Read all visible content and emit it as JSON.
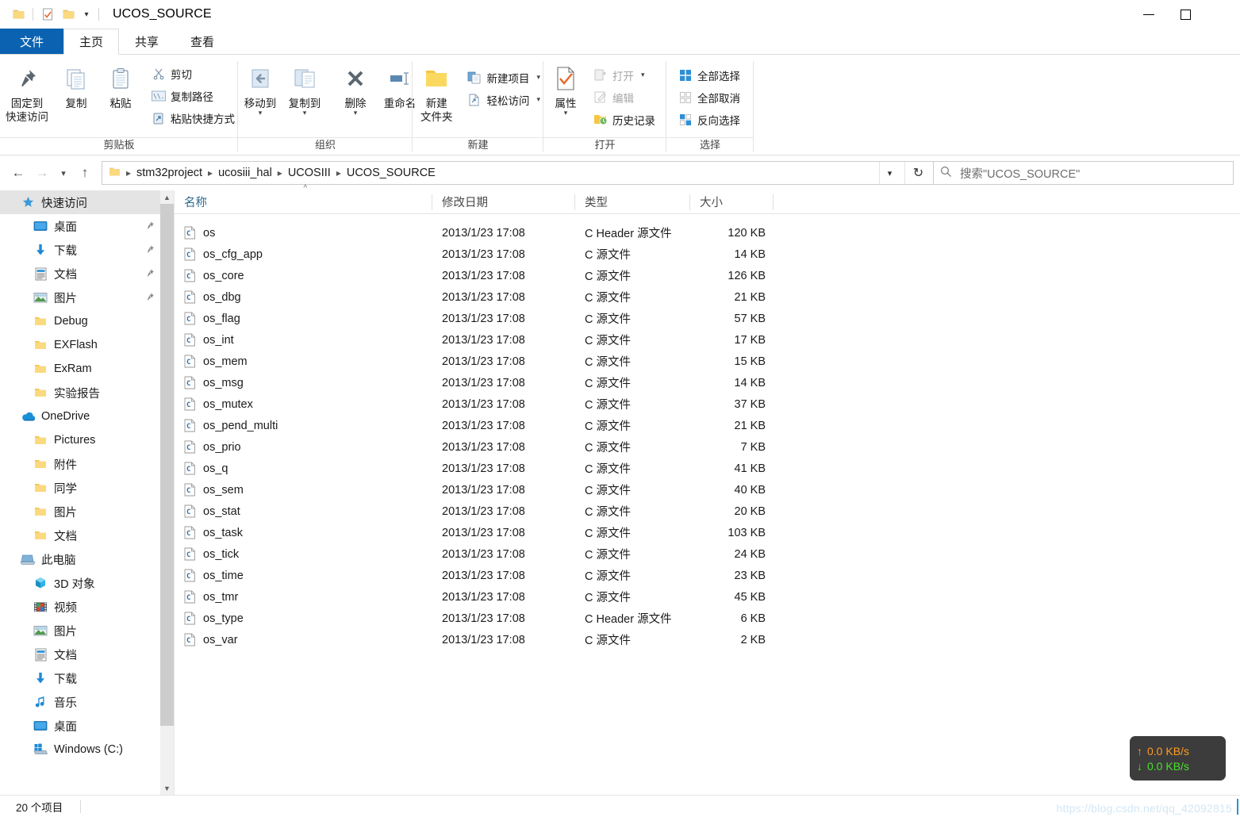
{
  "window": {
    "title": "UCOS_SOURCE",
    "minimize_label": "最小化",
    "maximize_label": "最大化",
    "quick_access": [
      "folder-icon",
      "properties-check-icon",
      "new-folder-icon",
      "customize-caret-icon"
    ]
  },
  "ribbon": {
    "tabs": [
      {
        "label": "文件",
        "kind": "file"
      },
      {
        "label": "主页",
        "kind": "active"
      },
      {
        "label": "共享",
        "kind": "normal"
      },
      {
        "label": "查看",
        "kind": "normal"
      }
    ],
    "groups": [
      {
        "name": "剪贴板",
        "big": [
          {
            "label_line1": "固定到",
            "label_line2": "快速访问",
            "icon": "pin-icon"
          },
          {
            "label_line1": "复制",
            "label_line2": "",
            "icon": "copy-icon"
          },
          {
            "label_line1": "粘贴",
            "label_line2": "",
            "icon": "paste-icon"
          }
        ],
        "small": [
          {
            "label": "剪切",
            "icon": "scissors-icon"
          },
          {
            "label": "复制路径",
            "icon": "copy-path-icon"
          },
          {
            "label": "粘贴快捷方式",
            "icon": "paste-shortcut-icon"
          }
        ]
      },
      {
        "name": "组织",
        "big": [
          {
            "label_line1": "移动到",
            "label_line2": "",
            "icon": "move-to-icon",
            "caret": true
          },
          {
            "label_line1": "复制到",
            "label_line2": "",
            "icon": "copy-to-icon",
            "caret": true
          },
          {
            "label_line1": "删除",
            "label_line2": "",
            "icon": "delete-x-icon",
            "caret": true
          },
          {
            "label_line1": "重命名",
            "label_line2": "",
            "icon": "rename-icon"
          }
        ],
        "small": []
      },
      {
        "name": "新建",
        "big": [
          {
            "label_line1": "新建",
            "label_line2": "文件夹",
            "icon": "new-folder-icon"
          }
        ],
        "small": [
          {
            "label": "新建项目",
            "icon": "new-item-icon",
            "caret": true
          },
          {
            "label": "轻松访问",
            "icon": "easy-access-icon",
            "caret": true
          }
        ]
      },
      {
        "name": "打开",
        "big": [
          {
            "label_line1": "属性",
            "label_line2": "",
            "icon": "properties-icon",
            "caret": true
          }
        ],
        "small": [
          {
            "label": "打开",
            "icon": "open-icon",
            "caret": true,
            "dim": true
          },
          {
            "label": "编辑",
            "icon": "edit-icon",
            "dim": true
          },
          {
            "label": "历史记录",
            "icon": "history-icon"
          }
        ]
      },
      {
        "name": "选择",
        "big": [],
        "small": [
          {
            "label": "全部选择",
            "icon": "select-all-icon"
          },
          {
            "label": "全部取消",
            "icon": "select-none-icon"
          },
          {
            "label": "反向选择",
            "icon": "invert-selection-icon"
          }
        ]
      }
    ]
  },
  "addressbar": {
    "back_icon": "back-arrow-icon",
    "forward_icon": "forward-arrow-icon",
    "recent_icon": "recent-locations-icon",
    "up_icon": "up-arrow-icon",
    "breadcrumbs": [
      "stm32project",
      "ucosiii_hal",
      "UCOSIII",
      "UCOS_SOURCE"
    ],
    "dropdown_icon": "chevron-down-icon",
    "refresh_icon": "refresh-icon"
  },
  "search": {
    "icon": "search-icon",
    "placeholder": "搜索\"UCOS_SOURCE\"",
    "value": ""
  },
  "sidebar": {
    "items": [
      {
        "label": "快速访问",
        "icon": "quick-access-star-icon",
        "level": 0,
        "selected": true,
        "pin": false
      },
      {
        "label": "桌面",
        "icon": "desktop-icon",
        "level": 1,
        "selected": false,
        "pin": true
      },
      {
        "label": "下载",
        "icon": "downloads-icon",
        "level": 1,
        "selected": false,
        "pin": true
      },
      {
        "label": "文档",
        "icon": "documents-icon",
        "level": 1,
        "selected": false,
        "pin": true
      },
      {
        "label": "图片",
        "icon": "pictures-icon",
        "level": 1,
        "selected": false,
        "pin": true
      },
      {
        "label": "Debug",
        "icon": "folder-icon",
        "level": 1,
        "selected": false,
        "pin": false
      },
      {
        "label": "EXFlash",
        "icon": "folder-icon",
        "level": 1,
        "selected": false,
        "pin": false
      },
      {
        "label": "ExRam",
        "icon": "folder-icon",
        "level": 1,
        "selected": false,
        "pin": false
      },
      {
        "label": "实验报告",
        "icon": "folder-icon",
        "level": 1,
        "selected": false,
        "pin": false
      },
      {
        "label": "OneDrive",
        "icon": "onedrive-cloud-icon",
        "level": 0,
        "selected": false,
        "pin": false
      },
      {
        "label": "Pictures",
        "icon": "folder-icon",
        "level": 1,
        "selected": false,
        "pin": false
      },
      {
        "label": "附件",
        "icon": "folder-icon",
        "level": 1,
        "selected": false,
        "pin": false
      },
      {
        "label": "同学",
        "icon": "folder-icon",
        "level": 1,
        "selected": false,
        "pin": false
      },
      {
        "label": "图片",
        "icon": "folder-icon",
        "level": 1,
        "selected": false,
        "pin": false
      },
      {
        "label": "文档",
        "icon": "folder-icon",
        "level": 1,
        "selected": false,
        "pin": false
      },
      {
        "label": "此电脑",
        "icon": "this-pc-icon",
        "level": 0,
        "selected": false,
        "pin": false
      },
      {
        "label": "3D 对象",
        "icon": "3d-objects-icon",
        "level": 1,
        "selected": false,
        "pin": false
      },
      {
        "label": "视频",
        "icon": "videos-icon",
        "level": 1,
        "selected": false,
        "pin": false
      },
      {
        "label": "图片",
        "icon": "pictures-icon",
        "level": 1,
        "selected": false,
        "pin": false
      },
      {
        "label": "文档",
        "icon": "documents-icon",
        "level": 1,
        "selected": false,
        "pin": false
      },
      {
        "label": "下载",
        "icon": "downloads-icon",
        "level": 1,
        "selected": false,
        "pin": false
      },
      {
        "label": "音乐",
        "icon": "music-icon",
        "level": 1,
        "selected": false,
        "pin": false
      },
      {
        "label": "桌面",
        "icon": "desktop-icon",
        "level": 1,
        "selected": false,
        "pin": false
      },
      {
        "label": "Windows (C:)",
        "icon": "windows-drive-icon",
        "level": 1,
        "selected": false,
        "pin": false
      }
    ]
  },
  "filelist": {
    "columns": [
      {
        "label": "名称",
        "key": "name",
        "sorted": true,
        "sort_dir": "asc"
      },
      {
        "label": "修改日期",
        "key": "date",
        "sorted": false
      },
      {
        "label": "类型",
        "key": "type",
        "sorted": false
      },
      {
        "label": "大小",
        "key": "size",
        "sorted": false
      }
    ],
    "rows": [
      {
        "name": "os",
        "date": "2013/1/23 17:08",
        "type": "C Header 源文件",
        "size": "120 KB"
      },
      {
        "name": "os_cfg_app",
        "date": "2013/1/23 17:08",
        "type": "C 源文件",
        "size": "14 KB"
      },
      {
        "name": "os_core",
        "date": "2013/1/23 17:08",
        "type": "C 源文件",
        "size": "126 KB"
      },
      {
        "name": "os_dbg",
        "date": "2013/1/23 17:08",
        "type": "C 源文件",
        "size": "21 KB"
      },
      {
        "name": "os_flag",
        "date": "2013/1/23 17:08",
        "type": "C 源文件",
        "size": "57 KB"
      },
      {
        "name": "os_int",
        "date": "2013/1/23 17:08",
        "type": "C 源文件",
        "size": "17 KB"
      },
      {
        "name": "os_mem",
        "date": "2013/1/23 17:08",
        "type": "C 源文件",
        "size": "15 KB"
      },
      {
        "name": "os_msg",
        "date": "2013/1/23 17:08",
        "type": "C 源文件",
        "size": "14 KB"
      },
      {
        "name": "os_mutex",
        "date": "2013/1/23 17:08",
        "type": "C 源文件",
        "size": "37 KB"
      },
      {
        "name": "os_pend_multi",
        "date": "2013/1/23 17:08",
        "type": "C 源文件",
        "size": "21 KB"
      },
      {
        "name": "os_prio",
        "date": "2013/1/23 17:08",
        "type": "C 源文件",
        "size": "7 KB"
      },
      {
        "name": "os_q",
        "date": "2013/1/23 17:08",
        "type": "C 源文件",
        "size": "41 KB"
      },
      {
        "name": "os_sem",
        "date": "2013/1/23 17:08",
        "type": "C 源文件",
        "size": "40 KB"
      },
      {
        "name": "os_stat",
        "date": "2013/1/23 17:08",
        "type": "C 源文件",
        "size": "20 KB"
      },
      {
        "name": "os_task",
        "date": "2013/1/23 17:08",
        "type": "C 源文件",
        "size": "103 KB"
      },
      {
        "name": "os_tick",
        "date": "2013/1/23 17:08",
        "type": "C 源文件",
        "size": "24 KB"
      },
      {
        "name": "os_time",
        "date": "2013/1/23 17:08",
        "type": "C 源文件",
        "size": "23 KB"
      },
      {
        "name": "os_tmr",
        "date": "2013/1/23 17:08",
        "type": "C 源文件",
        "size": "45 KB"
      },
      {
        "name": "os_type",
        "date": "2013/1/23 17:08",
        "type": "C Header 源文件",
        "size": "6 KB"
      },
      {
        "name": "os_var",
        "date": "2013/1/23 17:08",
        "type": "C 源文件",
        "size": "2 KB"
      }
    ]
  },
  "statusbar": {
    "item_count": "20 个项目"
  },
  "speed_widget": {
    "upload": "0.0 KB/s",
    "download": "0.0 KB/s",
    "upload_color": "#ff9b21",
    "download_color": "#49e02e",
    "background": "#3c3c3c"
  },
  "watermark": {
    "text": "https://blog.csdn.net/qq_42092815"
  },
  "colors": {
    "file_tab_blue": "#0b62b0",
    "sorted_column": "#2e6a8e",
    "selection_gray": "#e4e4e4"
  }
}
